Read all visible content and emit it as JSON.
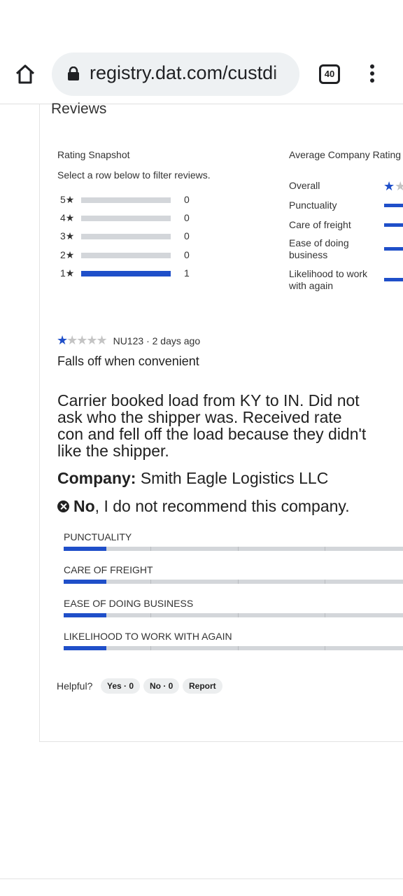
{
  "browser": {
    "url": "registry.dat.com/custdi",
    "tab_count": "40"
  },
  "reviews": {
    "section_title": "Reviews",
    "snapshot": {
      "title": "Rating Snapshot",
      "subtitle": "Select a row below to filter reviews.",
      "rows": [
        {
          "label": "5★",
          "count": "0",
          "fraction": 0
        },
        {
          "label": "4★",
          "count": "0",
          "fraction": 0
        },
        {
          "label": "3★",
          "count": "0",
          "fraction": 0
        },
        {
          "label": "2★",
          "count": "0",
          "fraction": 0
        },
        {
          "label": "1★",
          "count": "1",
          "fraction": 1
        }
      ]
    },
    "average": {
      "title": "Average Company Rating",
      "overall_label": "Overall",
      "overall_stars": 1,
      "rows": [
        {
          "label": "Punctuality"
        },
        {
          "label": "Care of freight"
        },
        {
          "label": "Ease of doing business"
        },
        {
          "label": "Likelihood to work with again"
        }
      ]
    },
    "review": {
      "stars": 1,
      "author": "NU123",
      "age": "· 2 days ago",
      "title": "Falls off when convenient",
      "body": "Carrier booked load from KY to IN. Did not ask who the shipper was. Received rate con and fell off the load because they didn't like the shipper.",
      "company_label": "Company:",
      "company_name": "Smith Eagle Logistics LLC",
      "recommend_no": "No",
      "recommend_text": ", I do not recommend this company.",
      "categories": [
        {
          "name": "PUNCTUALITY",
          "score": 1,
          "max": 4
        },
        {
          "name": "CARE OF FREIGHT",
          "score": 1,
          "max": 4
        },
        {
          "name": "EASE OF DOING BUSINESS",
          "score": 1,
          "max": 4
        },
        {
          "name": "LIKELIHOOD TO WORK WITH AGAIN",
          "score": 1,
          "max": 4
        }
      ],
      "helpful_label": "Helpful?",
      "yes_label": "Yes · 0",
      "no_label": "No · 0",
      "report_label": "Report"
    }
  },
  "colors": {
    "accent": "#1f4fc9",
    "track": "#d3d6da"
  }
}
